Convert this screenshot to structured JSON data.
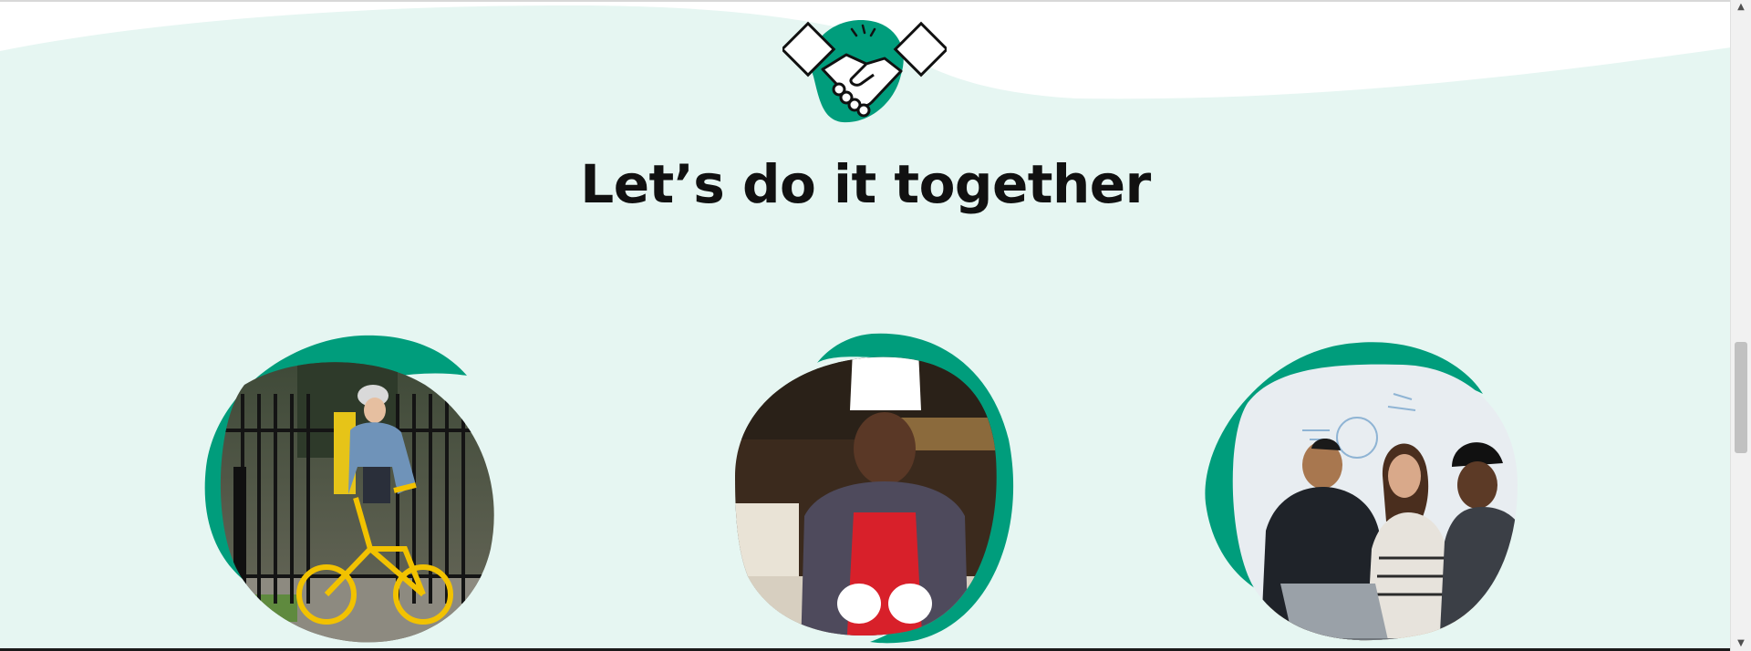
{
  "section": {
    "title": "Let’s do it together",
    "icon": "handshake-icon"
  },
  "cards": [
    {
      "image": "courier-on-yellow-bicycle-photo"
    },
    {
      "image": "chef-cutting-food-photo"
    },
    {
      "image": "team-around-laptop-photo"
    }
  ],
  "colors": {
    "band_background": "#e6f6f2",
    "accent_green": "#009d7c",
    "title_text": "#111111",
    "page_background": "#ffffff"
  }
}
